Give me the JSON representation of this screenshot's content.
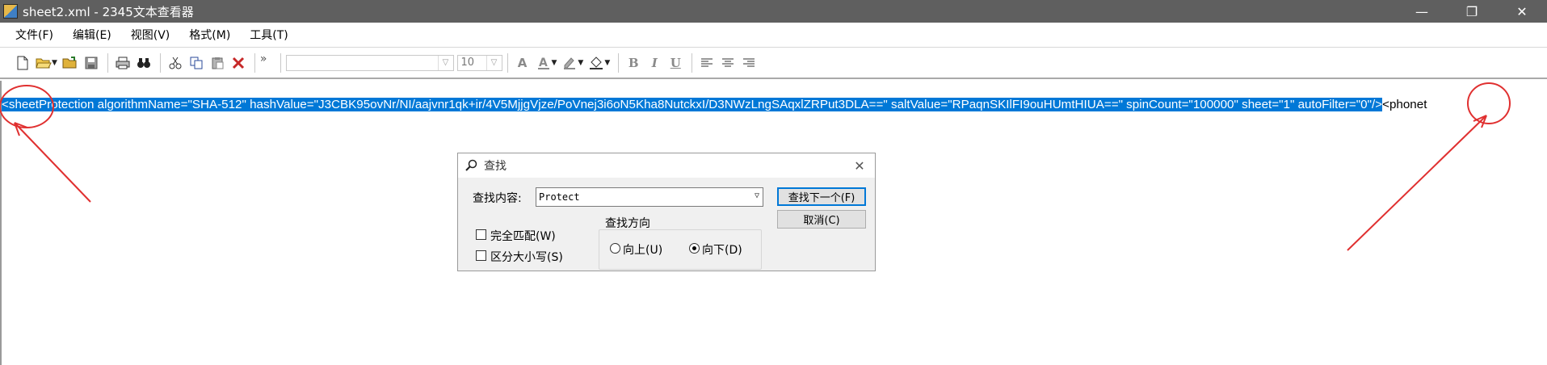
{
  "window": {
    "title": "sheet2.xml - 2345文本查看器",
    "minimize": "—",
    "restore": "❐",
    "close": "✕"
  },
  "menu": [
    "文件(F)",
    "编辑(E)",
    "视图(V)",
    "格式(M)",
    "工具(T)"
  ],
  "toolbar": {
    "overflow": "»",
    "font_name": "",
    "font_size": "10",
    "bold": "B",
    "italic": "I",
    "underline": "U"
  },
  "editor": {
    "selected_text": "<sheetProtection algorithmName=\"SHA-512\" hashValue=\"J3CBK95ovNr/NI/aajvnr1qk+ir/4V5MjjgVjze/PoVnej3i6oN5Kha8NutckxI/D3NWzLngSAqxlZRPut3DLA==\" saltValue=\"RPaqnSKIlFI9ouHUmtHIUA==\" spinCount=\"100000\" sheet=\"1\" autoFilter=\"0\"/>",
    "rest_text": "<phonet"
  },
  "find_dialog": {
    "title": "查找",
    "find_label": "查找内容:",
    "find_value": "Protect",
    "find_next": "查找下一个(F)",
    "cancel": "取消(C)",
    "match_whole": "完全匹配(W)",
    "match_case": "区分大小写(S)",
    "direction_label": "查找方向",
    "dir_up": "向上(U)",
    "dir_down": "向下(D)",
    "direction_selected": "down"
  },
  "colors": {
    "selection": "#0078d7",
    "annotation": "#e03030",
    "titlebar": "#5f5f5f"
  }
}
